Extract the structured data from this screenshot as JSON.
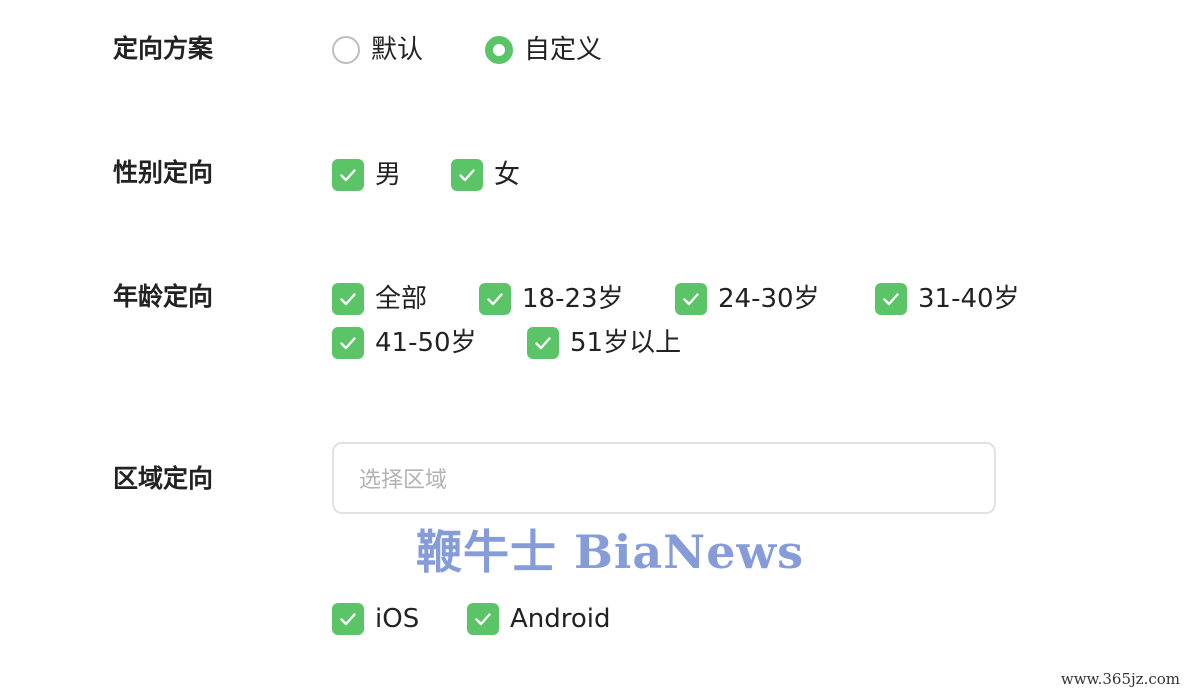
{
  "targeting_scheme": {
    "label": "定向方案",
    "options": [
      {
        "label": "默认",
        "selected": false
      },
      {
        "label": "自定义",
        "selected": true
      }
    ]
  },
  "gender_targeting": {
    "label": "性别定向",
    "options": [
      {
        "label": "男",
        "checked": true
      },
      {
        "label": "女",
        "checked": true
      }
    ]
  },
  "age_targeting": {
    "label": "年龄定向",
    "options": [
      {
        "label": "全部",
        "checked": true
      },
      {
        "label": "18-23岁",
        "checked": true
      },
      {
        "label": "24-30岁",
        "checked": true
      },
      {
        "label": "31-40岁",
        "checked": true
      },
      {
        "label": "41-50岁",
        "checked": true
      },
      {
        "label": "51岁以上",
        "checked": true
      }
    ]
  },
  "region_targeting": {
    "label": "区域定向",
    "placeholder": "选择区域"
  },
  "platform_targeting": {
    "options": [
      {
        "label": "iOS",
        "checked": true
      },
      {
        "label": "Android",
        "checked": true
      }
    ]
  },
  "watermark": {
    "text": "鞭牛士 BiaNews"
  },
  "corner_watermark": {
    "text": "www.365jz.com"
  },
  "colors": {
    "accent_green": "#5ac467",
    "label_text": "#222222",
    "placeholder_text": "#b3b3b3",
    "watermark_blue": "#7f97d8"
  },
  "icons": {
    "checkbox": "checkmark-icon",
    "radio": "radio-circle-icon"
  }
}
